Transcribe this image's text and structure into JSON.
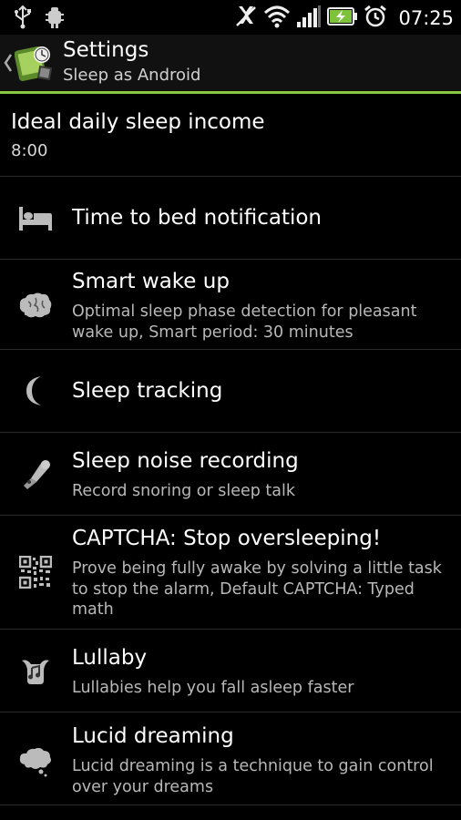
{
  "status_bar": {
    "time": "07:25",
    "icons": [
      "usb-icon",
      "debug-icon",
      "mute-icon",
      "wifi-icon",
      "signal-icon",
      "battery-charging-icon",
      "alarm-clock-icon"
    ]
  },
  "action_bar": {
    "title": "Settings",
    "subtitle": "Sleep as Android",
    "accent_color": "#8cc63f"
  },
  "settings": {
    "items": [
      {
        "title": "Ideal daily sleep income",
        "summary": "8:00",
        "icon": ""
      },
      {
        "title": "Time to bed notification",
        "summary": "",
        "icon": "bed-icon"
      },
      {
        "title": "Smart wake up",
        "summary": "Optimal sleep phase detection for pleasant wake up, Smart period: 30 minutes",
        "icon": "brain-icon"
      },
      {
        "title": "Sleep tracking",
        "summary": "",
        "icon": "moon-icon"
      },
      {
        "title": "Sleep noise recording",
        "summary": "Record snoring or sleep talk",
        "icon": "microphone-icon"
      },
      {
        "title": "CAPTCHA: Stop oversleeping!",
        "summary": "Prove being fully awake by solving a little task to stop the alarm, Default CAPTCHA: Typed math",
        "icon": "qr-code-icon"
      },
      {
        "title": "Lullaby",
        "summary": "Lullabies help you fall asleep faster",
        "icon": "lullaby-icon"
      },
      {
        "title": "Lucid dreaming",
        "summary": "Lucid dreaming is a technique to gain control over your dreams",
        "icon": "thought-cloud-icon"
      }
    ]
  }
}
